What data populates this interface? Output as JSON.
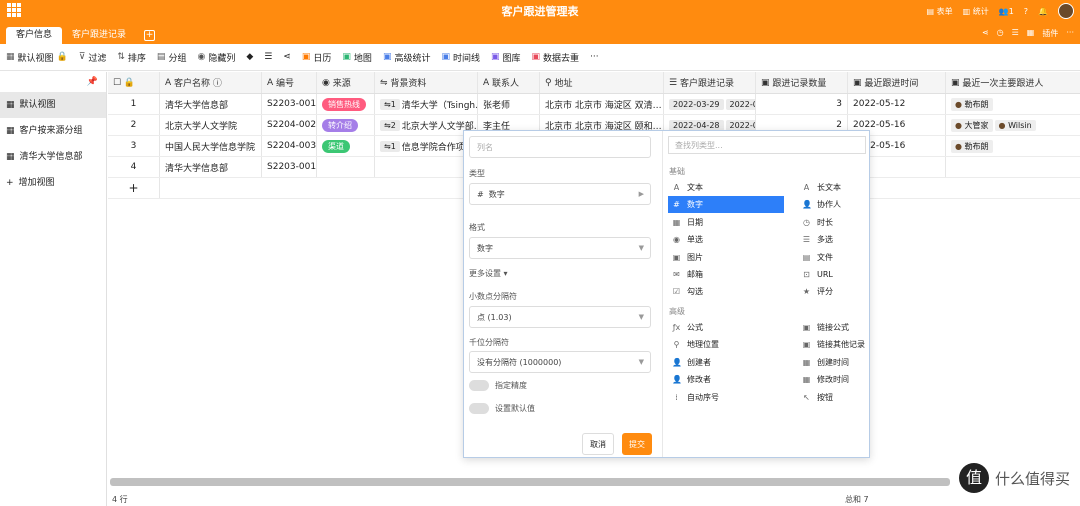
{
  "app": {
    "title": "客户跟进管理表",
    "tabs": [
      "客户信息",
      "客户跟进记录"
    ],
    "right_actions": [
      "表单",
      "统计",
      "1",
      "?"
    ],
    "right_actions2": [
      "插件"
    ]
  },
  "toolbar": [
    "默认视图",
    "过滤",
    "排序",
    "分组",
    "隐藏列",
    "日历",
    "地图",
    "高级统计",
    "时间线",
    "图库",
    "数据去重",
    "···"
  ],
  "sidebar": [
    "默认视图",
    "客户按来源分组",
    "清华大学信息部",
    "增加视图"
  ],
  "columns": [
    "客户名称",
    "编号",
    "来源",
    "背景资料",
    "联系人",
    "地址",
    "客户跟进记录",
    "跟进记录数量",
    "最近跟进时间",
    "最近一次主要跟进人"
  ],
  "rows": [
    {
      "n": "1",
      "name": "清华大学信息部",
      "id": "S2203-001",
      "src": "销售热线",
      "srccolor": "#ff5b7f",
      "bg": "清华大学（Tsingh…",
      "bgn": "1",
      "contact": "张老师",
      "addr": "北京市 北京市 海淀区 双清…",
      "rec": [
        "2022-03-29",
        "2022-0"
      ],
      "cnt": "3",
      "last": "2022-05-12",
      "people": [
        "勒布朗"
      ]
    },
    {
      "n": "2",
      "name": "北京大学人文学院",
      "id": "S2204-002",
      "src": "转介绍",
      "srccolor": "#a57ee8",
      "bg": "北京大学人文学部…",
      "bgn": "2",
      "contact": "李主任",
      "addr": "北京市 北京市 海淀区 颐和…",
      "rec": [
        "2022-04-28",
        "2022-0"
      ],
      "cnt": "2",
      "last": "2022-05-16",
      "people": [
        "大管家",
        "Wilsin"
      ]
    },
    {
      "n": "3",
      "name": "中国人民大学信息学院",
      "id": "S2204-003",
      "src": "渠道",
      "srccolor": "#3cc774",
      "bg": "信息学院合作项",
      "bgn": "1",
      "contact": "",
      "addr": "",
      "rec": [],
      "cnt": "",
      "last": "2022-05-16",
      "people": [
        "勒布朗"
      ]
    },
    {
      "n": "4",
      "name": "清华大学信息部",
      "id": "S2203-001",
      "src": "",
      "srccolor": "",
      "bg": "",
      "bgn": "",
      "contact": "",
      "addr": "",
      "rec": [],
      "cnt": "",
      "last": "",
      "people": []
    }
  ],
  "add_row": "+",
  "dialog": {
    "name_placeholder": "列名",
    "type_label": "类型",
    "type_value": "数字",
    "format_label": "格式",
    "format_value": "数字",
    "more": "更多设置 ▾",
    "decimal_label": "小数点分隔符",
    "decimal_value": "点 (1.03)",
    "thousand_label": "千位分隔符",
    "thousand_value": "没有分隔符 (1000000)",
    "precision": "指定精度",
    "default": "设置默认值",
    "cancel": "取消",
    "submit": "提交",
    "search_placeholder": "查找列类型...",
    "basic": "基础",
    "advanced": "高级",
    "types_left": [
      "文本",
      "数字",
      "日期",
      "单选",
      "图片",
      "邮箱",
      "勾选"
    ],
    "types_right": [
      "长文本",
      "协作人",
      "时长",
      "多选",
      "文件",
      "URL",
      "评分"
    ],
    "adv_left": [
      "公式",
      "地理位置",
      "创建者",
      "修改者",
      "自动序号"
    ],
    "adv_right": [
      "链接公式",
      "链接其他记录",
      "创建时间",
      "修改时间",
      "按钮"
    ]
  },
  "footer": {
    "rows": "4 行",
    "total": "总和 7"
  },
  "watermark": "什么值得买",
  "colors": {
    "accent": "#ff8b0f",
    "selected": "#2d7ff9"
  }
}
